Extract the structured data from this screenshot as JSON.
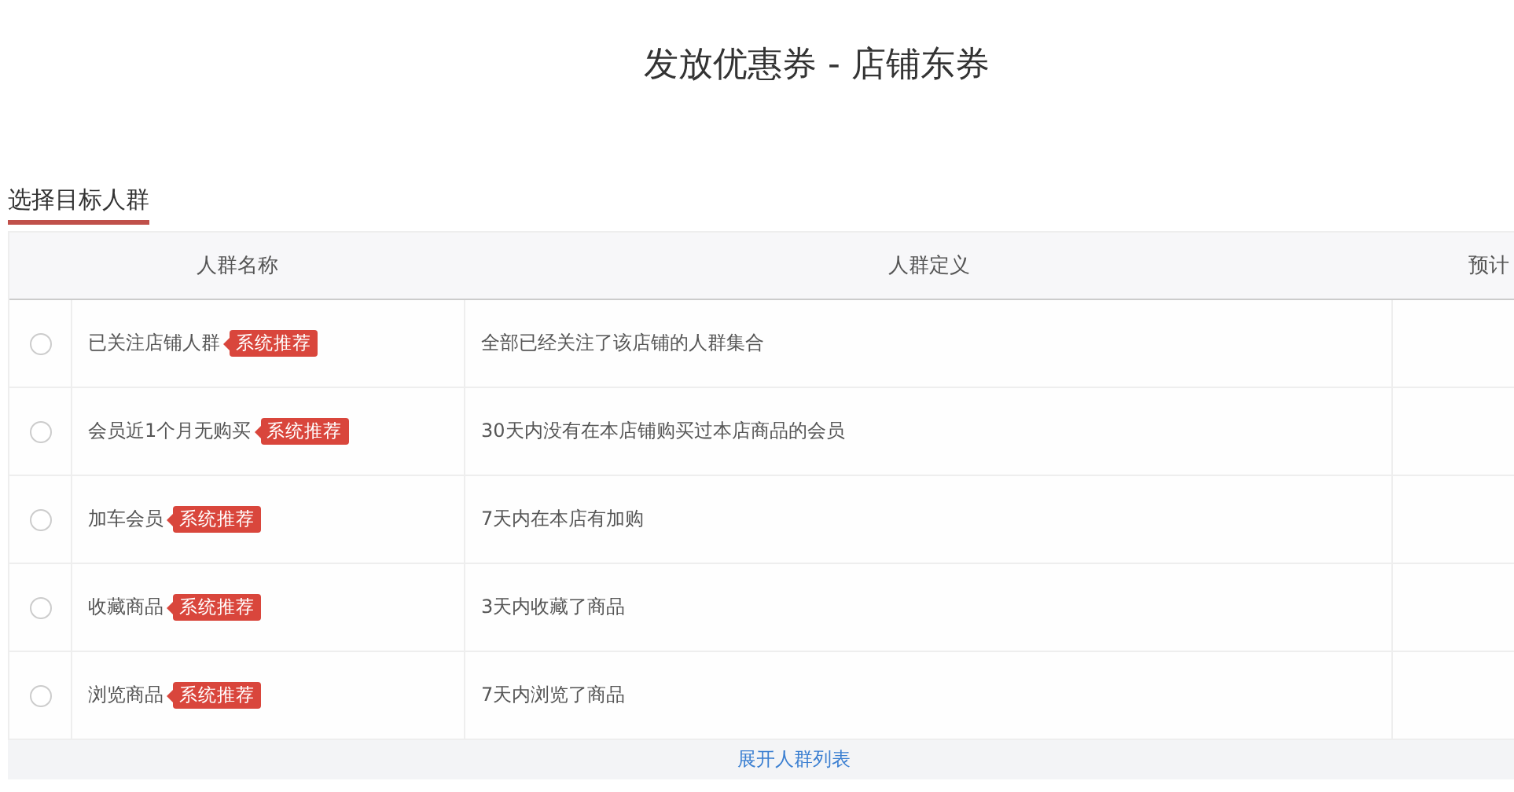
{
  "title": "发放优惠券 - 店铺东券",
  "section": {
    "heading": "选择目标人群"
  },
  "table": {
    "columns": [
      "人群名称",
      "人群定义",
      "预计"
    ],
    "rows": [
      {
        "name": "已关注店铺人群",
        "tag": "系统推荐",
        "definition": "全部已经关注了该店铺的人群集合",
        "selected": false
      },
      {
        "name": "会员近1个月无购买",
        "tag": "系统推荐",
        "definition": "30天内没有在本店铺购买过本店商品的会员",
        "selected": false
      },
      {
        "name": "加车会员",
        "tag": "系统推荐",
        "definition": "7天内在本店有加购",
        "selected": false
      },
      {
        "name": "收藏商品",
        "tag": "系统推荐",
        "definition": "3天内收藏了商品",
        "selected": false
      },
      {
        "name": "浏览商品",
        "tag": "系统推荐",
        "definition": "7天内浏览了商品",
        "selected": false
      }
    ]
  },
  "expand_link": "展开人群列表"
}
